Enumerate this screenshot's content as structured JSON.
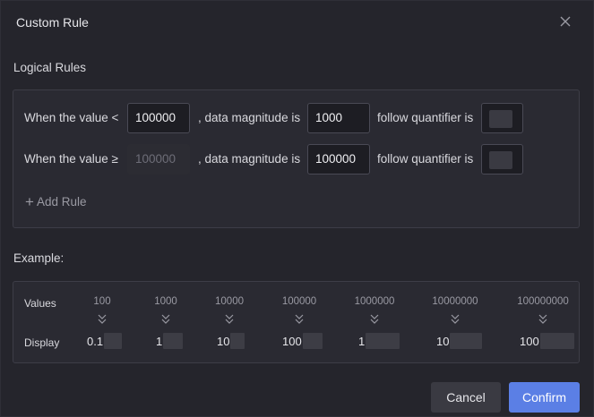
{
  "dialog": {
    "title": "Custom Rule",
    "logical_rules_label": "Logical Rules",
    "example_label": "Example:"
  },
  "rules": [
    {
      "condition": "When the value <",
      "threshold": "100000",
      "magnitude_text": ", data magnitude is",
      "magnitude": "1000",
      "quantifier_text": "follow quantifier is"
    },
    {
      "condition": "When the value ≥",
      "threshold": "100000",
      "magnitude_text": ", data magnitude is",
      "magnitude": "100000",
      "quantifier_text": "follow quantifier is"
    }
  ],
  "add_rule_label": "Add Rule",
  "example": {
    "values_label": "Values",
    "display_label": "Display",
    "values": [
      "100",
      "1000",
      "10000",
      "100000",
      "1000000",
      "10000000",
      "100000000"
    ],
    "displays": [
      "0.1",
      "1",
      "10",
      "100",
      "1",
      "10",
      "100"
    ]
  },
  "buttons": {
    "cancel": "Cancel",
    "confirm": "Confirm"
  },
  "colors": {
    "accent": "#5b7fe5",
    "background": "#25252c"
  }
}
